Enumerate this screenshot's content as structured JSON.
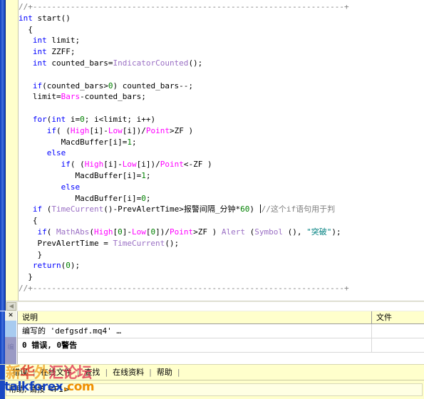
{
  "editor": {
    "code_lines": [
      [
        {
          "t": "cmt",
          "v": "//+------------------------------------------------------------------+"
        }
      ],
      [
        {
          "t": "kw",
          "v": "int"
        },
        {
          "t": "pln",
          "v": " start()"
        }
      ],
      [
        {
          "t": "pln",
          "v": "  {"
        }
      ],
      [
        {
          "t": "pln",
          "v": "   "
        },
        {
          "t": "kw",
          "v": "int"
        },
        {
          "t": "pln",
          "v": " limit;"
        }
      ],
      [
        {
          "t": "pln",
          "v": "   "
        },
        {
          "t": "kw",
          "v": "int"
        },
        {
          "t": "pln",
          "v": " ZZFF;"
        }
      ],
      [
        {
          "t": "pln",
          "v": "   "
        },
        {
          "t": "kw",
          "v": "int"
        },
        {
          "t": "pln",
          "v": " counted_bars="
        },
        {
          "t": "fn",
          "v": "IndicatorCounted"
        },
        {
          "t": "pln",
          "v": "();"
        }
      ],
      [
        {
          "t": "pln",
          "v": ""
        }
      ],
      [
        {
          "t": "pln",
          "v": "   "
        },
        {
          "t": "kw",
          "v": "if"
        },
        {
          "t": "pln",
          "v": "(counted_bars>"
        },
        {
          "t": "num",
          "v": "0"
        },
        {
          "t": "pln",
          "v": ") counted_bars--;"
        }
      ],
      [
        {
          "t": "pln",
          "v": "   limit="
        },
        {
          "t": "var",
          "v": "Bars"
        },
        {
          "t": "pln",
          "v": "-counted_bars;"
        }
      ],
      [
        {
          "t": "pln",
          "v": ""
        }
      ],
      [
        {
          "t": "pln",
          "v": "   "
        },
        {
          "t": "kw",
          "v": "for"
        },
        {
          "t": "pln",
          "v": "("
        },
        {
          "t": "kw",
          "v": "int"
        },
        {
          "t": "pln",
          "v": " i="
        },
        {
          "t": "num",
          "v": "0"
        },
        {
          "t": "pln",
          "v": "; i<limit; i++)"
        }
      ],
      [
        {
          "t": "pln",
          "v": "      "
        },
        {
          "t": "kw",
          "v": "if"
        },
        {
          "t": "pln",
          "v": "( ("
        },
        {
          "t": "var",
          "v": "High"
        },
        {
          "t": "pln",
          "v": "[i]-"
        },
        {
          "t": "var",
          "v": "Low"
        },
        {
          "t": "pln",
          "v": "[i])/"
        },
        {
          "t": "var",
          "v": "Point"
        },
        {
          "t": "pln",
          "v": ">ZF )"
        }
      ],
      [
        {
          "t": "pln",
          "v": "         MacdBuffer[i]="
        },
        {
          "t": "num",
          "v": "1"
        },
        {
          "t": "pln",
          "v": ";"
        }
      ],
      [
        {
          "t": "pln",
          "v": "      "
        },
        {
          "t": "kw",
          "v": "else"
        }
      ],
      [
        {
          "t": "pln",
          "v": "         "
        },
        {
          "t": "kw",
          "v": "if"
        },
        {
          "t": "pln",
          "v": "( ("
        },
        {
          "t": "var",
          "v": "High"
        },
        {
          "t": "pln",
          "v": "[i]-"
        },
        {
          "t": "var",
          "v": "Low"
        },
        {
          "t": "pln",
          "v": "[i])/"
        },
        {
          "t": "var",
          "v": "Point"
        },
        {
          "t": "pln",
          "v": "<-ZF )"
        }
      ],
      [
        {
          "t": "pln",
          "v": "            MacdBuffer[i]="
        },
        {
          "t": "num",
          "v": "1"
        },
        {
          "t": "pln",
          "v": ";"
        }
      ],
      [
        {
          "t": "pln",
          "v": "         "
        },
        {
          "t": "kw",
          "v": "else"
        }
      ],
      [
        {
          "t": "pln",
          "v": "            MacdBuffer[i]="
        },
        {
          "t": "num",
          "v": "0"
        },
        {
          "t": "pln",
          "v": ";"
        }
      ],
      [
        {
          "t": "pln",
          "v": "   "
        },
        {
          "t": "kw",
          "v": "if"
        },
        {
          "t": "pln",
          "v": " ("
        },
        {
          "t": "fn",
          "v": "TimeCurrent"
        },
        {
          "t": "pln",
          "v": "()-PrevAlertTime>报警间隔_分钟*"
        },
        {
          "t": "num",
          "v": "60"
        },
        {
          "t": "pln",
          "v": ") "
        },
        {
          "t": "caret",
          "v": ""
        },
        {
          "t": "cmt",
          "v": "//这个if语句用于判"
        }
      ],
      [
        {
          "t": "pln",
          "v": "   {"
        }
      ],
      [
        {
          "t": "pln",
          "v": "    "
        },
        {
          "t": "kw",
          "v": "if"
        },
        {
          "t": "pln",
          "v": "( "
        },
        {
          "t": "fn",
          "v": "MathAbs"
        },
        {
          "t": "pln",
          "v": "("
        },
        {
          "t": "var",
          "v": "High"
        },
        {
          "t": "pln",
          "v": "["
        },
        {
          "t": "num",
          "v": "0"
        },
        {
          "t": "pln",
          "v": "]-"
        },
        {
          "t": "var",
          "v": "Low"
        },
        {
          "t": "pln",
          "v": "["
        },
        {
          "t": "num",
          "v": "0"
        },
        {
          "t": "pln",
          "v": "])/"
        },
        {
          "t": "var",
          "v": "Point"
        },
        {
          "t": "pln",
          "v": ">ZF ) "
        },
        {
          "t": "fn",
          "v": "Alert"
        },
        {
          "t": "pln",
          "v": " ("
        },
        {
          "t": "fn",
          "v": "Symbol"
        },
        {
          "t": "pln",
          "v": " (), "
        },
        {
          "t": "str",
          "v": "\"突破\""
        },
        {
          "t": "pln",
          "v": ");"
        }
      ],
      [
        {
          "t": "pln",
          "v": "    PrevAlertTime = "
        },
        {
          "t": "fn",
          "v": "TimeCurrent"
        },
        {
          "t": "pln",
          "v": "();"
        }
      ],
      [
        {
          "t": "pln",
          "v": "    }"
        }
      ],
      [
        {
          "t": "pln",
          "v": "   "
        },
        {
          "t": "kw",
          "v": "return"
        },
        {
          "t": "pln",
          "v": "("
        },
        {
          "t": "num",
          "v": "0"
        },
        {
          "t": "pln",
          "v": ");"
        }
      ],
      [
        {
          "t": "pln",
          "v": "  }"
        }
      ],
      [
        {
          "t": "cmt",
          "v": "//+------------------------------------------------------------------+"
        }
      ]
    ],
    "hscroll_left_arrow": "scroll-left-arrow"
  },
  "panel": {
    "close_label": "✕",
    "tab_strip_label": "编",
    "columns": [
      {
        "key": "desc",
        "label": "说明"
      },
      {
        "key": "file",
        "label": "文件"
      }
    ],
    "rows": [
      {
        "desc": "编写的 'defgsdf.mq4' …",
        "file": "",
        "bold": false
      },
      {
        "desc": "0 错误,  0警告",
        "file": "",
        "bold": true
      }
    ]
  },
  "tabbar": {
    "items": [
      {
        "label": "错误"
      },
      {
        "label": "在线文件"
      },
      {
        "label": "查找"
      },
      {
        "label": "在线资料"
      },
      {
        "label": "帮助"
      }
    ],
    "separator": "|"
  },
  "statusbar": {
    "text": "帮助, 请按 <F1>"
  },
  "watermark": {
    "cn": [
      {
        "ch": "新",
        "cls": "wm-c1"
      },
      {
        "ch": "华",
        "cls": "wm-c2"
      },
      {
        "ch": "外",
        "cls": "wm-c3"
      },
      {
        "ch": "汇",
        "cls": "wm-c4"
      },
      {
        "ch": "论",
        "cls": "wm-c5"
      },
      {
        "ch": "坛",
        "cls": "wm-c6"
      }
    ],
    "en_blue": "talkforex",
    "en_orange": ".com"
  },
  "colors": {
    "keyword": "#0000ff",
    "function": "#9a6fc4",
    "variable": "#ff00ff",
    "number": "#008000",
    "string": "#008080",
    "comment": "#808080",
    "gutter": "#ffffcc",
    "dock": "#1949c4",
    "panel_header": "#ffffcc"
  }
}
